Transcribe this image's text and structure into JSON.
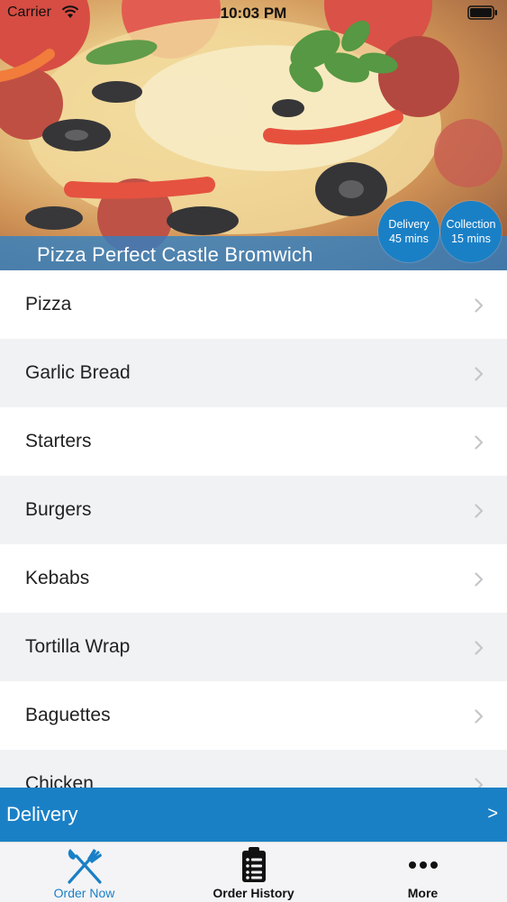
{
  "status_bar": {
    "carrier": "Carrier",
    "time": "10:03 PM"
  },
  "hero": {
    "restaurant_name": "Pizza Perfect Castle Bromwich",
    "delivery_badge": {
      "label": "Delivery",
      "time": "45 mins"
    },
    "collection_badge": {
      "label": "Collection",
      "time": "15 mins"
    }
  },
  "categories": [
    {
      "label": "Pizza"
    },
    {
      "label": "Garlic Bread"
    },
    {
      "label": "Starters"
    },
    {
      "label": "Burgers"
    },
    {
      "label": "Kebabs"
    },
    {
      "label": "Tortilla Wrap"
    },
    {
      "label": "Baguettes"
    },
    {
      "label": "Chicken"
    }
  ],
  "delivery_bar": {
    "label": "Delivery",
    "arrow": ">"
  },
  "tabs": [
    {
      "label": "Order Now",
      "icon": "fork-knife-icon",
      "active": true
    },
    {
      "label": "Order History",
      "icon": "clipboard-list-icon",
      "active": false
    },
    {
      "label": "More",
      "icon": "more-dots-icon",
      "active": false
    }
  ],
  "colors": {
    "accent": "#1a80c6",
    "row_alt": "#f1f2f4",
    "tab_bar": "#f4f4f6"
  }
}
